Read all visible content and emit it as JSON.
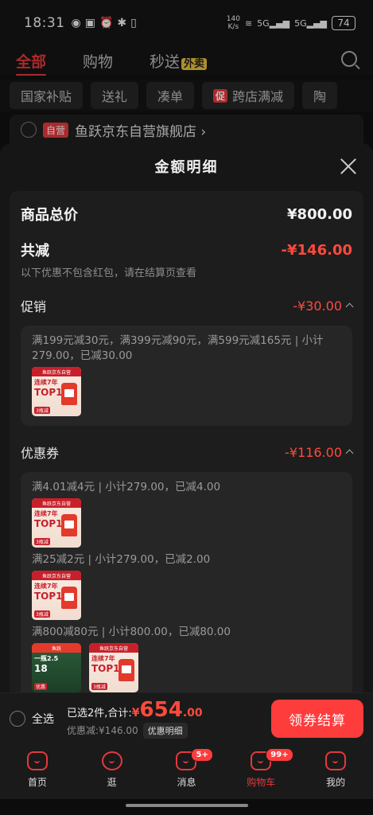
{
  "status_bar": {
    "time": "18:31",
    "net_speed_value": "140",
    "net_speed_unit": "K/s",
    "signal1": "5G",
    "signal2": "5G",
    "battery": "74"
  },
  "top_tabs": [
    {
      "label": "全部"
    },
    {
      "label": "购物"
    },
    {
      "label": "秒送"
    }
  ],
  "takeout_badge": "外卖",
  "filter_chips": [
    {
      "label": "国家补贴"
    },
    {
      "label": "送礼"
    },
    {
      "label": "凑单"
    },
    {
      "label": "跨店满减",
      "tag": "促"
    },
    {
      "label": "陶"
    }
  ],
  "shop": {
    "self_tag": "自营",
    "name": "鱼跃京东自营旗舰店 ›"
  },
  "sheet": {
    "title": "金额明细",
    "total_label": "商品总价",
    "total_value": "¥800.00",
    "reduce_label": "共减",
    "reduce_value": "-¥146.00",
    "note": "以下优惠不包含红包，请在结算页查看",
    "promo": {
      "label": "促销",
      "value": "-¥30.00",
      "rule": "满199元减30元，满399元减90元，满599元减165元 | 小计279.00，已减30.00"
    },
    "coupon": {
      "label": "优惠券",
      "value": "-¥116.00",
      "lines": [
        "满4.01减4元 | 小计279.00，已减4.00",
        "满25减2元 | 小计279.00，已减2.00",
        "满800减80元 | 小计800.00，已减80.00"
      ]
    },
    "product_thumb": {
      "header": "鱼跃京东自营",
      "line1": "连续7年",
      "line2": "TOP1",
      "foot": "3瓶减"
    },
    "product_thumb_alt": {
      "header": "鱼跃",
      "line1": "一瓶2.5",
      "line2": "18",
      "foot": "优惠"
    }
  },
  "checkout": {
    "select_all": "全选",
    "selected_text": "已选2件,合计:",
    "price_symbol": "¥",
    "price_int": "654",
    "price_dec": ".00",
    "discount_text": "优惠减:¥146.00",
    "detail_label": "优惠明细",
    "button": "领券结算"
  },
  "bottom_nav": [
    {
      "label": "首页"
    },
    {
      "label": "逛"
    },
    {
      "label": "消息",
      "badge": "5+"
    },
    {
      "label": "购物车",
      "badge": "99+"
    },
    {
      "label": "我的"
    }
  ],
  "colors": {
    "accent": "#e4393c",
    "price_red": "#ff4a3d",
    "button_red": "#ff3c3c",
    "background": "#111111"
  }
}
